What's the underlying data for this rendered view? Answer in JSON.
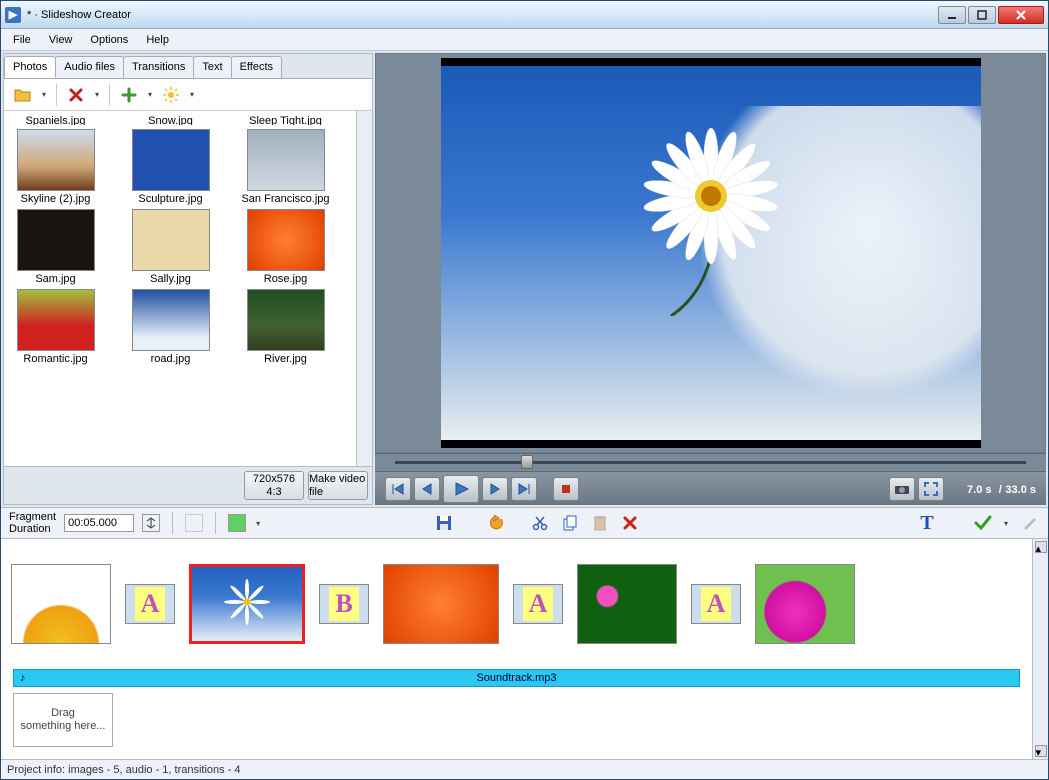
{
  "window": {
    "title": "* · Slideshow Creator"
  },
  "menu": [
    "File",
    "View",
    "Options",
    "Help"
  ],
  "tabs": [
    "Photos",
    "Audio files",
    "Transitions",
    "Text",
    "Effects"
  ],
  "active_tab": 0,
  "gallery": {
    "row0": [
      "Spaniels.jpg",
      "Snow.jpg",
      "Sleep Tight.jpg"
    ],
    "rows": [
      [
        "Skyline (2).jpg",
        "Sculpture.jpg",
        "San Francisco.jpg"
      ],
      [
        "Sam.jpg",
        "Sally.jpg",
        "Rose.jpg"
      ],
      [
        "Romantic.jpg",
        "road.jpg",
        "River.jpg"
      ]
    ]
  },
  "left_buttons": {
    "res1": "720x576",
    "res2": "4:3",
    "make": "Make video file"
  },
  "playback": {
    "current": "7.0 s",
    "sep": "/",
    "total": "33.0 s"
  },
  "fragment": {
    "label1": "Fragment",
    "label2": "Duration",
    "value": "00:05.000"
  },
  "audio": {
    "track": "Soundtrack.mp3"
  },
  "drop": {
    "l1": "Drag",
    "l2": "something here..."
  },
  "status": "Project info: images - 5, audio - 1, transitions - 4",
  "timeline_letters": [
    "A",
    "B",
    "A",
    "A"
  ]
}
